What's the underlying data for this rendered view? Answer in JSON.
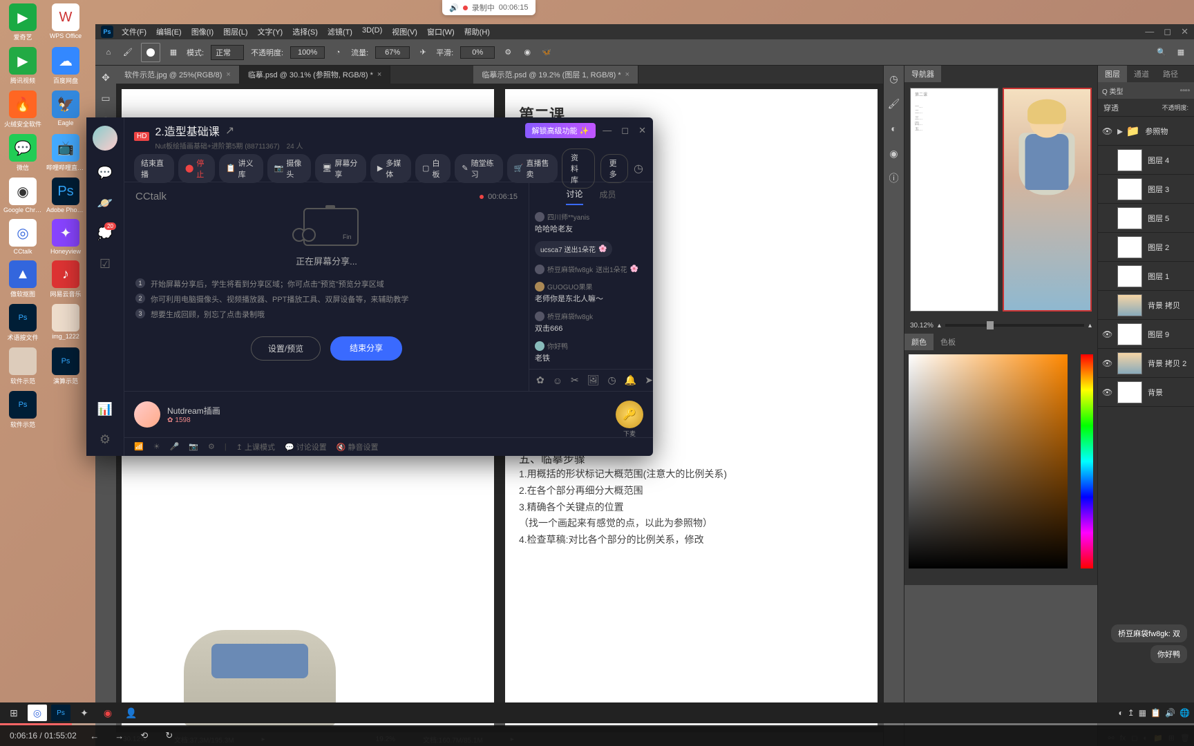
{
  "recording": {
    "label": "录制中",
    "time": "00:06:15"
  },
  "desktop_icons": [
    [
      {
        "label": "爱奇艺",
        "bg": "#1aaa44"
      },
      {
        "label": "WPS Office",
        "bg": "#fff"
      }
    ],
    [
      {
        "label": "腾讯视频",
        "bg": "#ff8800"
      },
      {
        "label": "百度网盘",
        "bg": "#3388ff"
      }
    ],
    [
      {
        "label": "火绒安全软件",
        "bg": "#ff6622"
      },
      {
        "label": "Eagle",
        "bg": "#3388dd"
      }
    ],
    [
      {
        "label": "微信",
        "bg": "#22cc55"
      },
      {
        "label": "哔哩哔哩直播姬",
        "bg": "#44aaff"
      }
    ],
    [
      {
        "label": "Google Chrome",
        "bg": "#fff"
      },
      {
        "label": "Adobe Photoshop",
        "bg": "#001e36"
      }
    ],
    [
      {
        "label": "CCtalk",
        "bg": "#fff"
      },
      {
        "label": "Honeyview",
        "bg": "#8844ff"
      }
    ],
    [
      {
        "label": "傲软抠图",
        "bg": "#3366dd"
      },
      {
        "label": "网易云音乐",
        "bg": "#dd3333"
      }
    ],
    [
      {
        "label": "术语按文件",
        "bg": "#001e36"
      },
      {
        "label": "img_1222",
        "bg": "#eeddcc"
      }
    ],
    [
      {
        "label": "软件示范",
        "bg": "#ddccbb"
      },
      {
        "label": "演算示范",
        "bg": "#001e36"
      }
    ],
    [
      {
        "label": "软件示范",
        "bg": "#001e36"
      }
    ]
  ],
  "photoshop": {
    "menu": [
      "文件(F)",
      "编辑(E)",
      "图像(I)",
      "图层(L)",
      "文字(Y)",
      "选择(S)",
      "滤镜(T)",
      "3D(D)",
      "视图(V)",
      "窗口(W)",
      "帮助(H)"
    ],
    "toolbar": {
      "mode_label": "模式:",
      "mode_value": "正常",
      "opacity_label": "不透明度:",
      "opacity_value": "100%",
      "flow_label": "流量:",
      "flow_value": "67%",
      "smooth_label": "平滑:",
      "smooth_value": "0%"
    },
    "tabs": [
      {
        "label": "软件示范.jpg @ 25%(RGB/8)"
      },
      {
        "label": "临摹.psd @ 30.1% (参照物, RGB/8) *"
      },
      {
        "label": "临摹示范.psd @ 19.2% (图层 1, RGB/8) *"
      }
    ],
    "canvas2": {
      "title": "第二课",
      "section_h": "五、临摹步骤",
      "steps": [
        "1.用概括的形状标记大概范围(注意大的比例关系)",
        "2.在各个部分再细分大概范围",
        "3.精确各个关键点的位置",
        "（找一个画起来有感觉的点，以此为参照物）",
        "4.检查草稿:对比各个部分的比例关系，修改"
      ]
    },
    "status": {
      "zoom1": "30.12%",
      "doc1": "文档:37.3M/195.3M",
      "zoom2": "19.2%",
      "doc2": "文档:160.7M/85.1M"
    },
    "nav": {
      "title": "导航器",
      "zoom": "30.12%"
    },
    "layers": {
      "title": "图层",
      "tabs": [
        "图层",
        "通道",
        "路径"
      ],
      "filter": "Q 类型",
      "blend": "穿透",
      "opacity_label": "不透明度:",
      "folder": "参照物",
      "items": [
        "图层 4",
        "图层 3",
        "图层 5",
        "图层 2",
        "图层 1",
        "背景 拷贝",
        "图层 9",
        "背景 拷贝 2",
        "背景"
      ]
    },
    "color": {
      "tab1": "颜色",
      "tab2": "色板"
    }
  },
  "cctalk": {
    "hd": "HD",
    "title": "2.造型基础课",
    "subtitle": "Nut板绘插画基础+进阶第5期 (88711367)　24 人",
    "unlock": "解锁高级功能",
    "toolbar": {
      "end_live": "结束直播",
      "stop": "停止",
      "lecture": "讲义库",
      "camera": "摄像头",
      "screen": "屏幕分享",
      "media": "多媒体",
      "whiteboard": "白板",
      "practice": "随堂练习",
      "sell": "直播售卖",
      "material": "资料库",
      "more": "更多"
    },
    "brand": "CCtalk",
    "timer": "00:06:15",
    "share_status": "正在屏幕分享...",
    "tips": [
      "开始屏幕分享后，学生将看到分享区域；你可点击\"预览\"预览分享区域",
      "你可利用电脑摄像头、视频播放器、PPT播放工具、双屏设备等，来辅助教学",
      "想要生成回顾，别忘了点击录制哦"
    ],
    "preview_btn": "设置/预览",
    "end_share_btn": "结束分享",
    "right_tabs": {
      "discuss": "讨论",
      "members": "成员"
    },
    "chat": [
      {
        "user": "四川师**yanis",
        "text": "哈哈哈老友"
      },
      {
        "gift": "ucsca7 送出1朵花"
      },
      {
        "user": "桥豆麻袋fw8gk",
        "gift_text": "送出1朵花"
      },
      {
        "user": "GUOGUO果果",
        "text": "老师你是东北人嘛～"
      },
      {
        "user": "桥豆麻袋fw8gk",
        "text": "双击666"
      },
      {
        "user": "你好鸭",
        "text": "老铁"
      }
    ],
    "teacher": {
      "name": "Nutdream插画",
      "points": "1598"
    },
    "mic_label": "下麦",
    "bottom": {
      "upload": "上课模式",
      "discuss": "讨论设置",
      "mute": "静音设置"
    },
    "side_badge": "20"
  },
  "tooltips": {
    "t1": "桥豆麻袋fw8gk: 双",
    "t2": "你好鸭"
  },
  "video": {
    "current": "0:06:16",
    "total": "01:55:02"
  }
}
